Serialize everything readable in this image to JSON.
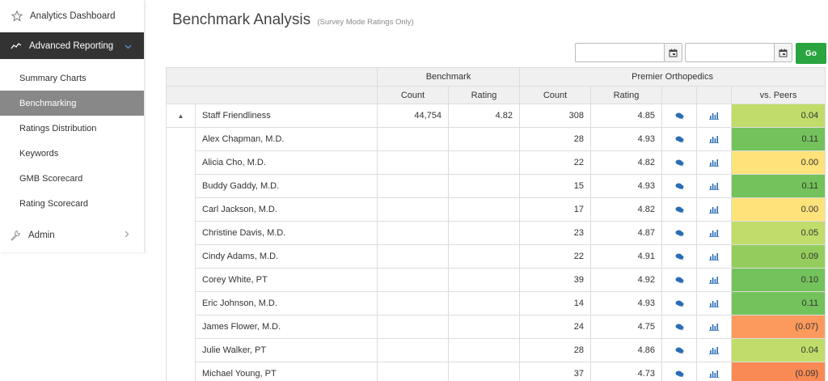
{
  "sidebar": {
    "analytics": "Analytics Dashboard",
    "advanced": "Advanced Reporting",
    "items": [
      {
        "label": "Summary Charts"
      },
      {
        "label": "Benchmarking"
      },
      {
        "label": "Ratings Distribution"
      },
      {
        "label": "Keywords"
      },
      {
        "label": "GMB Scorecard"
      },
      {
        "label": "Rating Scorecard"
      }
    ],
    "admin": "Admin"
  },
  "header": {
    "title": "Benchmark Analysis",
    "subtitle": "(Survey Mode Ratings Only)"
  },
  "controls": {
    "start_date": "",
    "end_date": "",
    "go_label": "Go"
  },
  "table": {
    "group_benchmark": "Benchmark",
    "group_practice": "Premier Orthopedics",
    "col_count": "Count",
    "col_rating": "Rating",
    "col_vs": "vs. Peers",
    "main_row": {
      "toggle": "▲",
      "label": "Staff Friendliness",
      "bench_count": "44,754",
      "bench_rating": "4.82",
      "count": "308",
      "rating": "4.85",
      "vs": "0.04"
    },
    "rows": [
      {
        "name": "Alex Chapman, M.D.",
        "count": "28",
        "rating": "4.93",
        "vs": "0.11"
      },
      {
        "name": "Alicia Cho, M.D.",
        "count": "22",
        "rating": "4.82",
        "vs": "0.00"
      },
      {
        "name": "Buddy Gaddy, M.D.",
        "count": "15",
        "rating": "4.93",
        "vs": "0.11"
      },
      {
        "name": "Carl Jackson, M.D.",
        "count": "17",
        "rating": "4.82",
        "vs": "0.00"
      },
      {
        "name": "Christine Davis, M.D.",
        "count": "23",
        "rating": "4.87",
        "vs": "0.05"
      },
      {
        "name": "Cindy Adams, M.D.",
        "count": "22",
        "rating": "4.91",
        "vs": "0.09"
      },
      {
        "name": "Corey White, PT",
        "count": "39",
        "rating": "4.92",
        "vs": "0.10"
      },
      {
        "name": "Eric Johnson, M.D.",
        "count": "14",
        "rating": "4.93",
        "vs": "0.11"
      },
      {
        "name": "James Flower, M.D.",
        "count": "24",
        "rating": "4.75",
        "vs": "(0.07)"
      },
      {
        "name": "Julie Walker, PT",
        "count": "28",
        "rating": "4.86",
        "vs": "0.04"
      },
      {
        "name": "Michael Young, PT",
        "count": "37",
        "rating": "4.73",
        "vs": "(0.09)"
      }
    ]
  },
  "colors": {
    "sidebar_active": "#333333",
    "go_button": "#2aa43f",
    "icon_blue": "#2a6db5"
  },
  "icons": {
    "comments": "chat-bubbles-icon",
    "chart": "bar-chart-icon"
  }
}
